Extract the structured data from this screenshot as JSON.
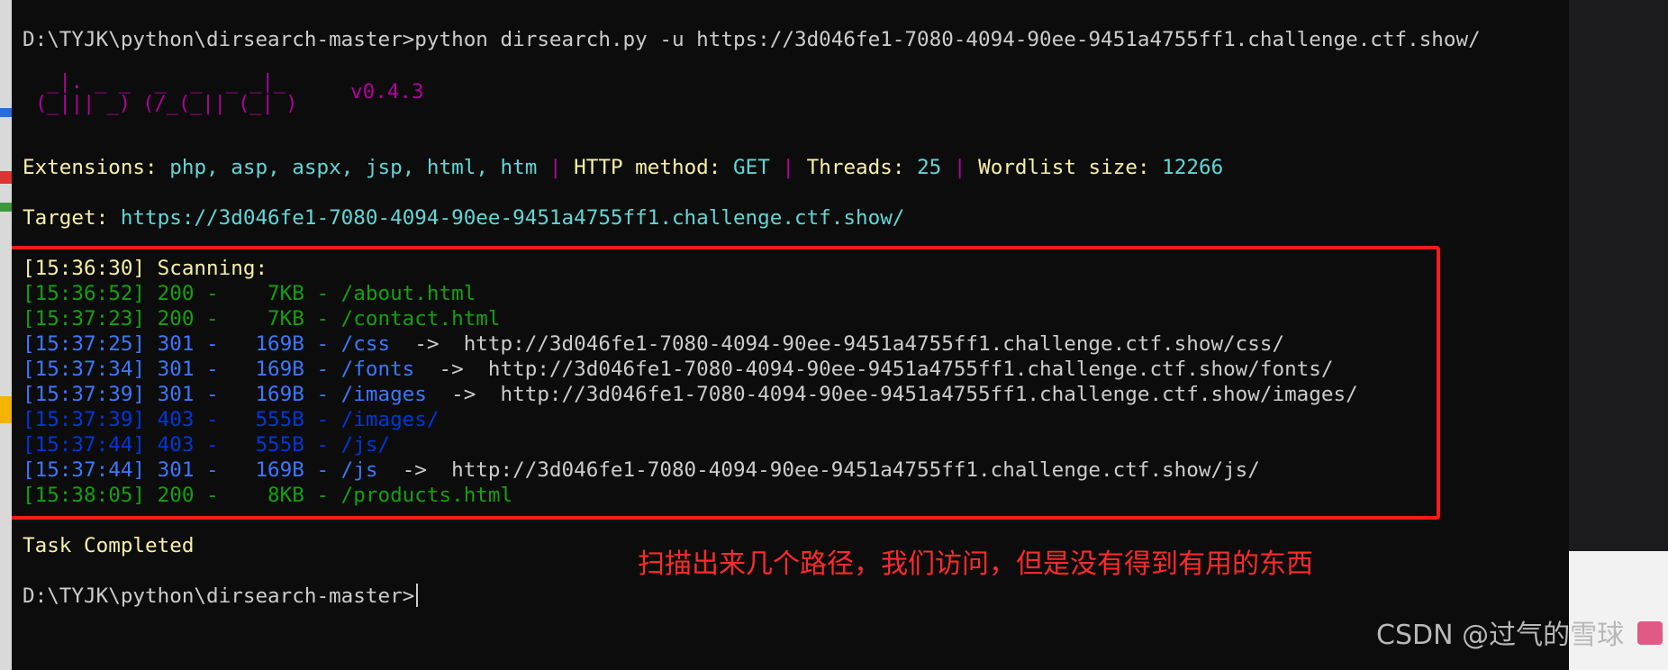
{
  "terminal": {
    "command_prompt": "D:\\TYJK\\python\\dirsearch-master>",
    "command": "python dirsearch.py -u https://3d046fe1-7080-4094-90ee-9451a4755ff1.challenge.ctf.show/",
    "banner": {
      "line1": " _|. _ _  _  _  _ _|_",
      "line2": "(_||| _) (/_(_|| (_| )",
      "version": "v0.4.3"
    },
    "config": {
      "extensions_label": "Extensions:",
      "extensions_value": "php, asp, aspx, jsp, html, htm",
      "separator": "|",
      "method_label": "HTTP method:",
      "method_value": "GET",
      "threads_label": "Threads:",
      "threads_value": "25",
      "wordlist_label": "Wordlist size:",
      "wordlist_value": "12266"
    },
    "target_label": "Target:",
    "target_value": "https://3d046fe1-7080-4094-90ee-9451a4755ff1.challenge.ctf.show/",
    "scanning_line": "[15:36:30] Scanning:",
    "results": [
      {
        "text": "[15:36:52] 200 -    7KB - /about.html",
        "color": "green"
      },
      {
        "text": "[15:37:23] 200 -    7KB - /contact.html",
        "color": "green"
      },
      {
        "text": "[15:37:25] 301 -   169B - /css",
        "redirect": "  ->  http://3d046fe1-7080-4094-90ee-9451a4755ff1.challenge.ctf.show/css/",
        "color": "blue"
      },
      {
        "text": "[15:37:34] 301 -   169B - /fonts",
        "redirect": "  ->  http://3d046fe1-7080-4094-90ee-9451a4755ff1.challenge.ctf.show/fonts/",
        "color": "blue"
      },
      {
        "text": "[15:37:39] 301 -   169B - /images",
        "redirect": "  ->  http://3d046fe1-7080-4094-90ee-9451a4755ff1.challenge.ctf.show/images/",
        "color": "blue"
      },
      {
        "text": "[15:37:39] 403 -   555B - /images/",
        "color": "darkblue"
      },
      {
        "text": "[15:37:44] 403 -   555B - /js/",
        "color": "darkblue"
      },
      {
        "text": "[15:37:44] 301 -   169B - /js",
        "redirect": "  ->  http://3d046fe1-7080-4094-90ee-9451a4755ff1.challenge.ctf.show/js/",
        "color": "blue"
      },
      {
        "text": "[15:38:05] 200 -    8KB - /products.html",
        "color": "green"
      }
    ],
    "task_completed": "Task Completed",
    "final_prompt": "D:\\TYJK\\python\\dirsearch-master>"
  },
  "annotation": {
    "text": "扫描出来几个路径，我们访问，但是没有得到有用的东西",
    "color": "#ff2a2a"
  },
  "watermark": "CSDN @过气的雪球",
  "colors": {
    "background": "#0c0c0c",
    "green": "#13a10e",
    "blue": "#3b78ff",
    "darkblue": "#0037da",
    "yellow": "#f9f1a5",
    "cyan": "#61d6d6",
    "magenta": "#b4009e",
    "highlight": "#ff1a1a"
  }
}
